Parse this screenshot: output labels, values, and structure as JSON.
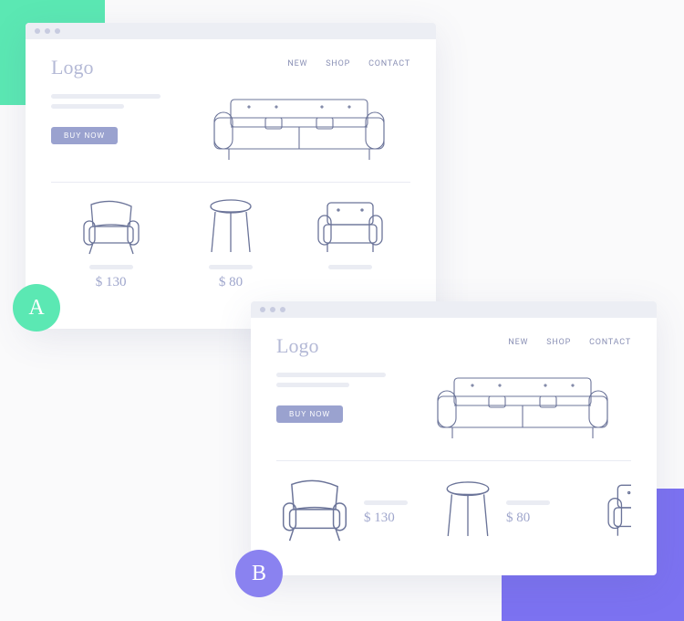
{
  "brand_logo_text": "Logo",
  "nav": {
    "new": "NEW",
    "shop": "SHOP",
    "contact": "CONTACT"
  },
  "cta": {
    "buy_now": "BUY NOW"
  },
  "labels": {
    "mockup_a": "A",
    "mockup_b": "B"
  },
  "products": [
    {
      "id": "armchair",
      "price_text": "$ 130",
      "price_value": 130,
      "currency": "USD",
      "icon": "armchair-icon"
    },
    {
      "id": "stool",
      "price_text": "$ 80",
      "price_value": 80,
      "currency": "USD",
      "icon": "stool-icon"
    },
    {
      "id": "loveseat",
      "price_text": "",
      "price_value": null,
      "currency": "USD",
      "icon": "loveseat-icon"
    }
  ],
  "colors": {
    "accent_green": "#5be8b3",
    "accent_purple": "#8a82f0",
    "muted": "#9fa6cc",
    "cta_bg": "#9aa2cf"
  }
}
